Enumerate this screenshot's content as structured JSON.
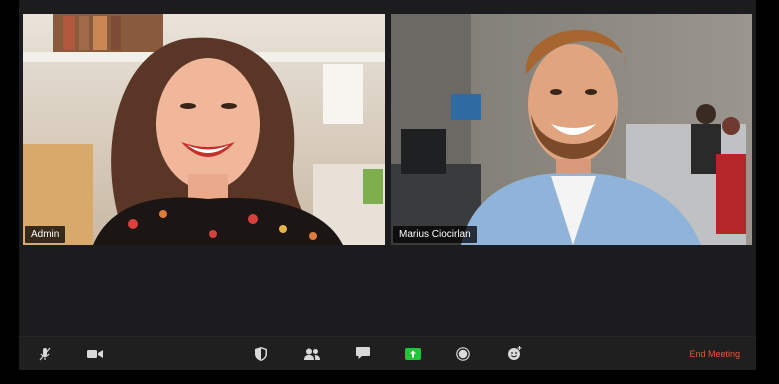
{
  "participants": [
    {
      "name": "Admin",
      "active_speaker": true
    },
    {
      "name": "Marius Ciocirlan",
      "active_speaker": false
    }
  ],
  "toolbar": {
    "icons": [
      "mute-icon",
      "video-icon",
      "security-icon",
      "participants-icon",
      "chat-icon",
      "share-screen-icon",
      "record-icon",
      "reactions-icon"
    ],
    "end_label": "End Meeting"
  },
  "colors": {
    "active_speaker_border": "#c4e25a",
    "share_screen": "#28c13a",
    "end_meeting": "#e8563a"
  }
}
